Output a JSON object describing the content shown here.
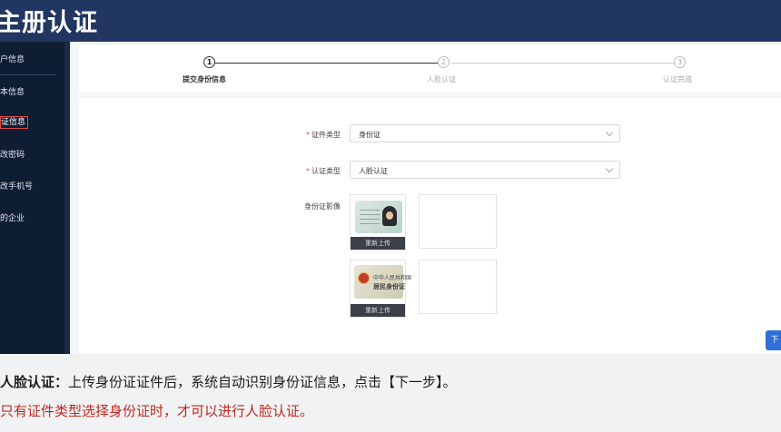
{
  "header": {
    "title": "主册认证"
  },
  "sidebar": {
    "items": [
      {
        "label": "户信息"
      },
      {
        "label": "本信息"
      },
      {
        "label": "证信息"
      },
      {
        "label": "改密码"
      },
      {
        "label": "改手机号"
      },
      {
        "label": "的企业"
      }
    ],
    "active_index": 2
  },
  "steps": [
    {
      "number": "1",
      "label": "提交身份信息",
      "state": "done"
    },
    {
      "number": "2",
      "label": "人脸认证",
      "state": "todo"
    },
    {
      "number": "3",
      "label": "认证完成",
      "state": "todo"
    }
  ],
  "form": {
    "cert_type": {
      "label": "证件类型",
      "value": "身份证"
    },
    "auth_type": {
      "label": "认证类型",
      "value": "人脸认证"
    },
    "id_image": {
      "label": "身份证影像"
    },
    "upload_front_label": "重新上传",
    "upload_back_label": "重新上传",
    "card_back_text_line1": "中华人民共和国",
    "card_back_text_line2": "居民身份证"
  },
  "next_button": {
    "label": "下"
  },
  "caption": {
    "line1_bold": "人脸认证：",
    "line1_text": "上传身份证证件后，系统自动识别身份证信息，点击【下一步】。",
    "line2": "只有证件类型选择身份证时，才可以进行人脸认证。"
  },
  "colors": {
    "header_bg": "#213660",
    "sidebar_bg": "#0f1d33",
    "required_star": "#e04a4a",
    "caption_note": "#c0281e",
    "step_done": "#333333",
    "step_todo": "#bbbbbb",
    "primary": "#2f6fd6"
  }
}
